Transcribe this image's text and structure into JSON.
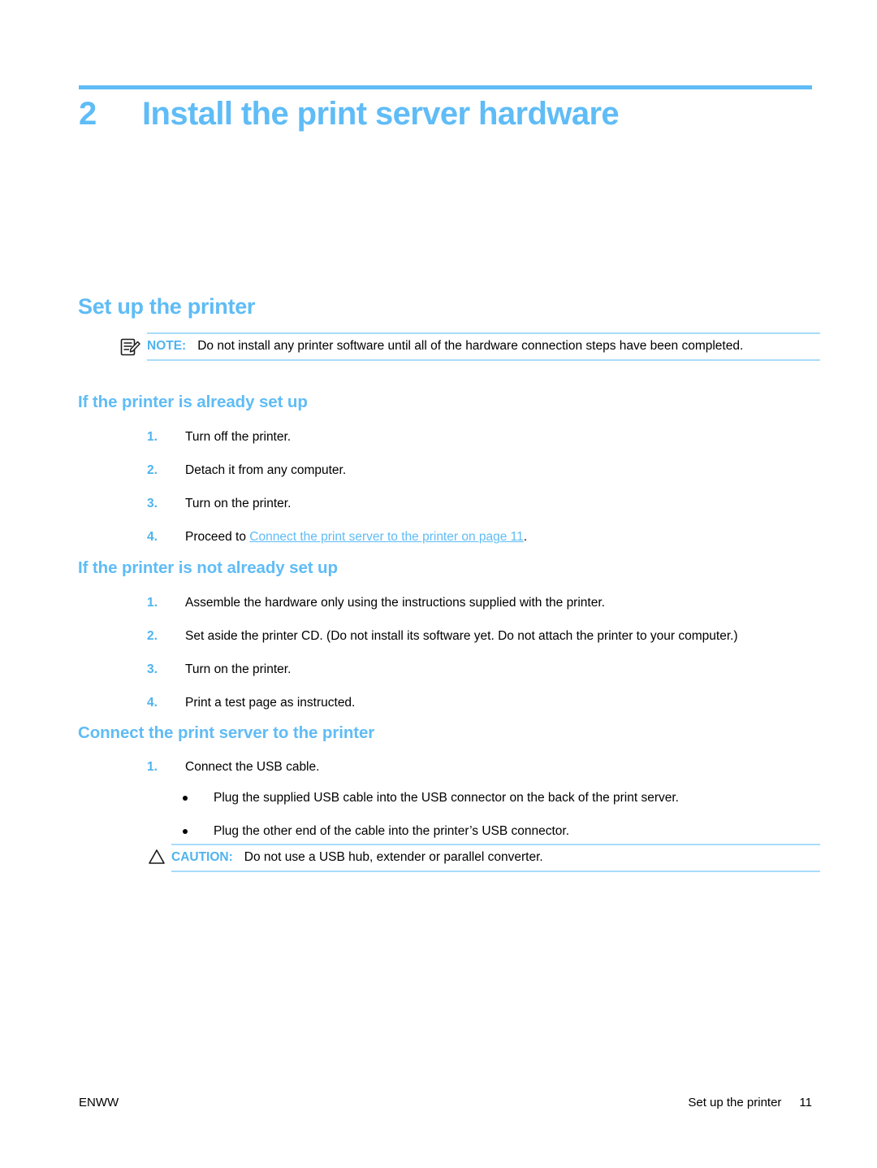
{
  "colors": {
    "accent_blue": "#5FBCF6",
    "label_blue": "#4FB3EE",
    "rule_blue": "#A9DCFA",
    "text_black": "#000000"
  },
  "chapter": {
    "number": "2",
    "title": "Install the print server hardware"
  },
  "section": {
    "heading": "Set up the printer"
  },
  "note": {
    "icon_name": "note-icon",
    "label": "NOTE:",
    "text": "Do not install any printer software until all of the hardware connection steps have been completed."
  },
  "subsection_already": {
    "heading": "If the printer is already set up",
    "items": [
      {
        "num": "1.",
        "text": "Turn off the printer."
      },
      {
        "num": "2.",
        "text": "Detach it from any computer."
      },
      {
        "num": "3.",
        "text": "Turn on the printer."
      },
      {
        "num": "4.",
        "prefix": "Proceed to ",
        "link": "Connect the print server to the printer on page 11",
        "suffix": "."
      }
    ]
  },
  "subsection_not_already": {
    "heading": "If the printer is not already set up",
    "items": [
      {
        "num": "1.",
        "text": "Assemble the hardware only using the instructions supplied with the printer."
      },
      {
        "num": "2.",
        "text": "Set aside the printer CD. (Do not install its software yet. Do not attach the printer to your computer.)"
      },
      {
        "num": "3.",
        "text": "Turn on the printer."
      },
      {
        "num": "4.",
        "text": "Print a test page as instructed."
      }
    ]
  },
  "subsection_connect": {
    "heading": "Connect the print server to the printer",
    "items": [
      {
        "num": "1.",
        "text": "Connect the USB cable."
      }
    ],
    "bullets": [
      "Plug the supplied USB cable into the USB connector on the back of the print server.",
      "Plug the other end of the cable into the printer’s USB connector."
    ]
  },
  "caution": {
    "icon_name": "caution-triangle-icon",
    "label": "CAUTION:",
    "text": "Do not use a USB hub, extender or parallel converter."
  },
  "footer": {
    "left": "ENWW",
    "right_title": "Set up the printer",
    "page_number": "11"
  }
}
